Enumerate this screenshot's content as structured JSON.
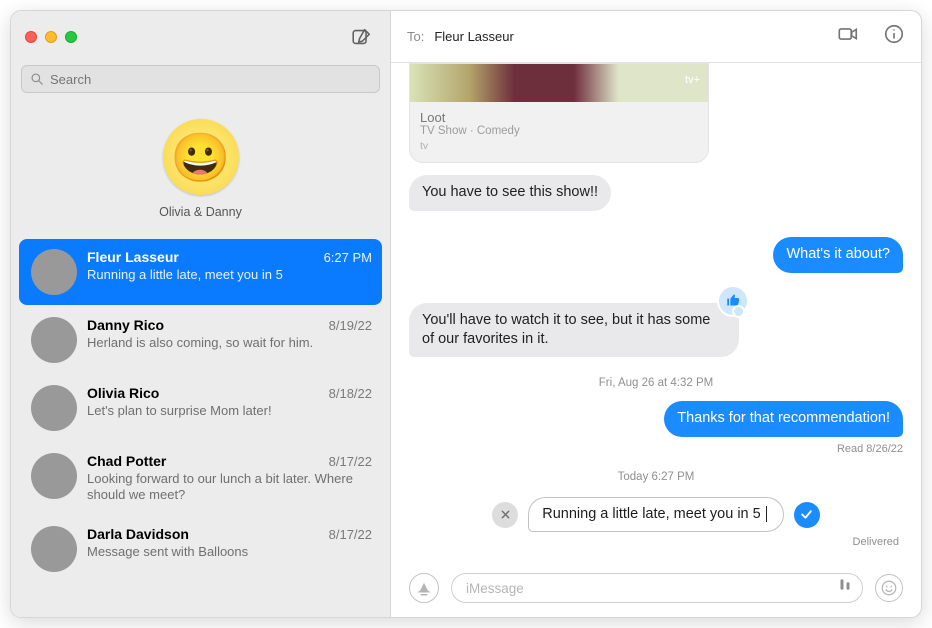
{
  "search": {
    "placeholder": "Search"
  },
  "pinned": {
    "emoji": "😀",
    "name": "Olivia & Danny"
  },
  "conversations": [
    {
      "name": "Fleur Lasseur",
      "time": "6:27 PM",
      "preview": "Running a little late, meet you in 5",
      "selected": true
    },
    {
      "name": "Danny Rico",
      "time": "8/19/22",
      "preview": "Herland is also coming, so wait for him.",
      "selected": false
    },
    {
      "name": "Olivia Rico",
      "time": "8/18/22",
      "preview": "Let's plan to surprise Mom later!",
      "selected": false
    },
    {
      "name": "Chad Potter",
      "time": "8/17/22",
      "preview": "Looking forward to our lunch a bit later. Where should we meet?",
      "selected": false
    },
    {
      "name": "Darla Davidson",
      "time": "8/17/22",
      "preview": "Message sent with Balloons",
      "selected": false
    }
  ],
  "header": {
    "to_label": "To:",
    "to_name": "Fleur Lasseur"
  },
  "card": {
    "badge": "tv+",
    "title": "Loot",
    "sub": "TV Show · Comedy",
    "source": "tv"
  },
  "msgs": {
    "m1": "You have to see this show!!",
    "m2": "What's it about?",
    "m3": "You'll have to watch it to see, but it has some of our favorites in it.",
    "ts1": "Fri, Aug 26 at 4:32 PM",
    "m4": "Thanks for that recommendation!",
    "read": "Read 8/26/22",
    "ts2": "Today 6:27 PM",
    "m5": "Running a little late, meet you in 5",
    "delivered": "Delivered"
  },
  "input": {
    "placeholder": "iMessage"
  }
}
